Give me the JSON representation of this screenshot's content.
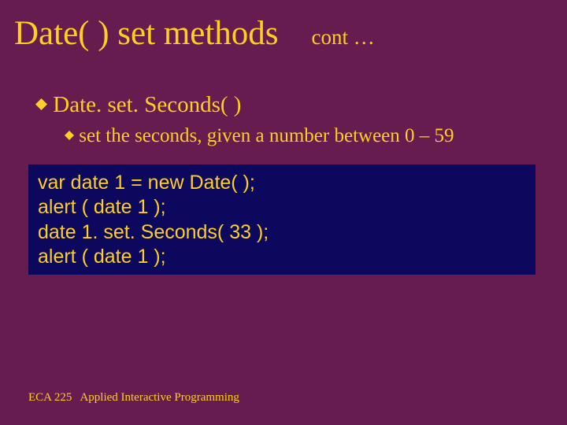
{
  "title": {
    "main": "Date( ) set methods",
    "cont": "cont …"
  },
  "bullets": {
    "l1": "Date. set. Seconds( )",
    "l2": "set the seconds, given a number between 0 – 59"
  },
  "code": {
    "l1": "var date 1 = new Date( );",
    "l2": "alert ( date 1 );",
    "l3": "date 1. set. Seconds( 33 );",
    "l4": "alert ( date 1 );"
  },
  "footer": {
    "course": "ECA 225",
    "title": "Applied Interactive Programming"
  }
}
